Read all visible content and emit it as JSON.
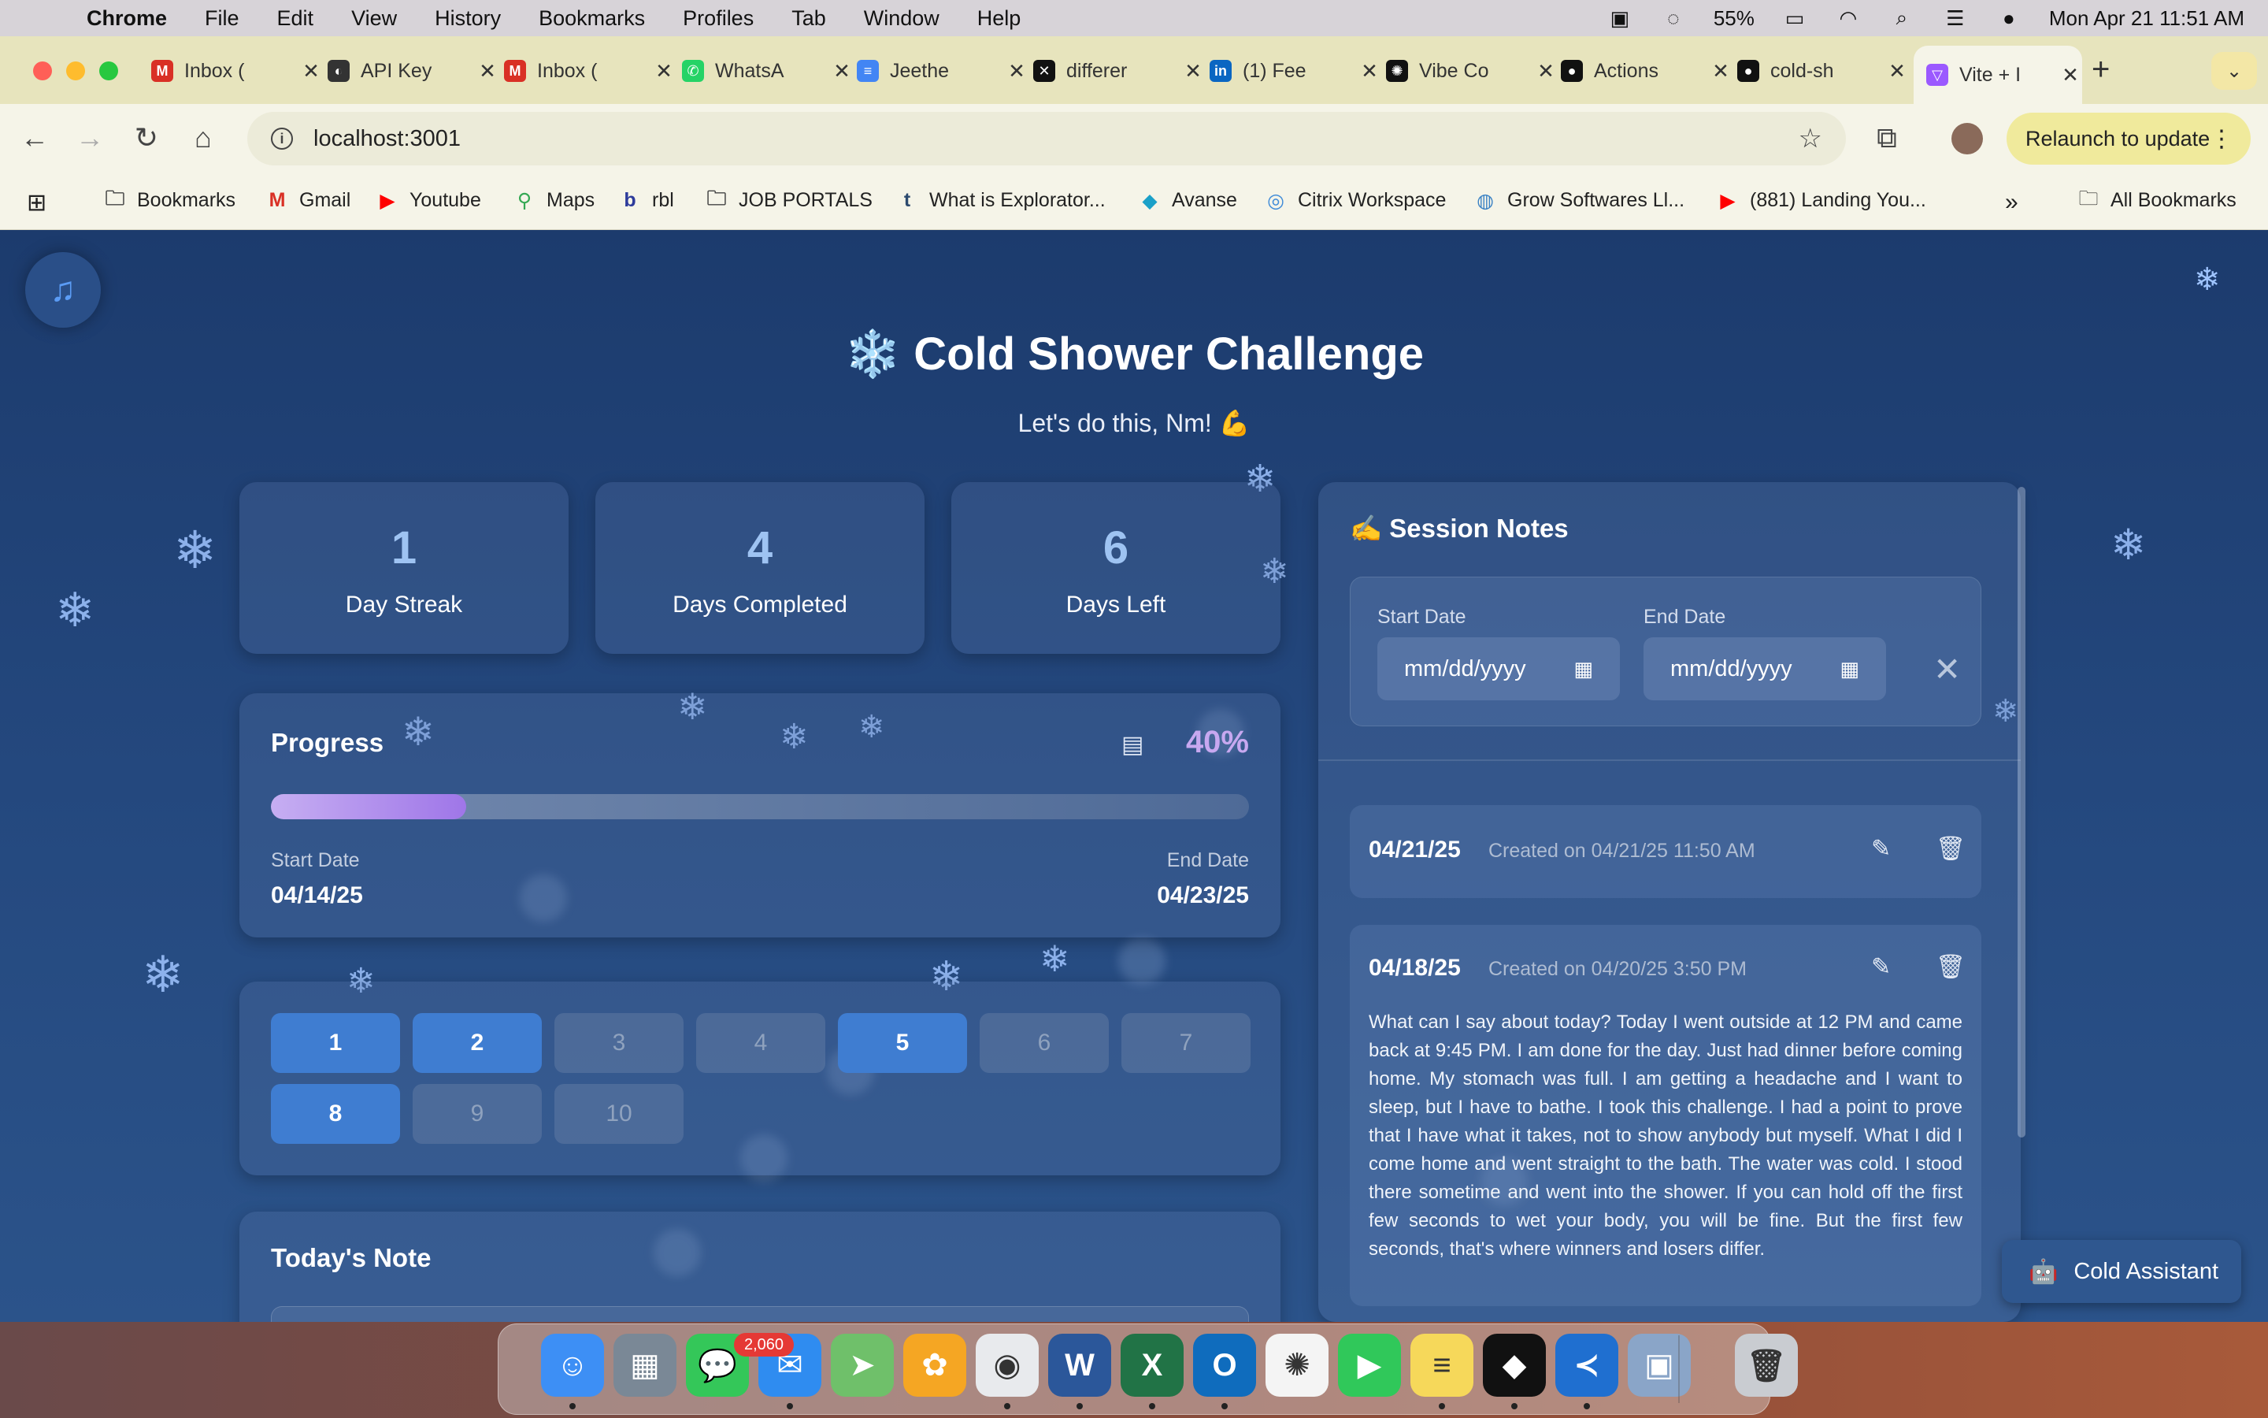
{
  "menubar": {
    "app": "Chrome",
    "items": [
      "File",
      "Edit",
      "View",
      "History",
      "Bookmarks",
      "Profiles",
      "Tab",
      "Window",
      "Help"
    ],
    "battery": "55%",
    "clock": "Mon Apr 21  11:51 AM"
  },
  "tabs": [
    {
      "title": "Inbox (",
      "icon": "gmail-icon",
      "color": "#d93025",
      "glyph": "M"
    },
    {
      "title": "API Key",
      "icon": "figma-icon",
      "color": "#333",
      "glyph": "◐"
    },
    {
      "title": "Inbox (",
      "icon": "gmail-icon",
      "color": "#d93025",
      "glyph": "M"
    },
    {
      "title": "WhatsA",
      "icon": "whatsapp-icon",
      "color": "#25d366",
      "glyph": "✆"
    },
    {
      "title": "Jeethe",
      "icon": "docs-icon",
      "color": "#4285f4",
      "glyph": "≡"
    },
    {
      "title": "differer",
      "icon": "site-icon",
      "color": "#111",
      "glyph": "✕"
    },
    {
      "title": "(1) Fee",
      "icon": "linkedin-icon",
      "color": "#0a66c2",
      "glyph": "in"
    },
    {
      "title": "Vibe Co",
      "icon": "openai-icon",
      "color": "#111",
      "glyph": "✺"
    },
    {
      "title": "Actions",
      "icon": "github-icon",
      "color": "#111",
      "glyph": "●"
    },
    {
      "title": "cold-sh",
      "icon": "github-icon",
      "color": "#111",
      "glyph": "●"
    },
    {
      "title": "Vite + I",
      "icon": "vite-icon",
      "color": "#9b59ff",
      "glyph": "▽",
      "active": true
    }
  ],
  "toolbar": {
    "url": "localhost:3001",
    "relaunch": "Relaunch to update"
  },
  "bookmarks": [
    {
      "label": "Bookmarks",
      "icon": "folder-icon"
    },
    {
      "label": "Gmail",
      "icon": "gmail-icon"
    },
    {
      "label": "Youtube",
      "icon": "youtube-icon"
    },
    {
      "label": "Maps",
      "icon": "maps-icon"
    },
    {
      "label": "rbl",
      "icon": "rbl-icon"
    },
    {
      "label": "JOB PORTALS",
      "icon": "folder-icon"
    },
    {
      "label": "What is Explorator...",
      "icon": "tds-icon"
    },
    {
      "label": "Avanse",
      "icon": "avanse-icon"
    },
    {
      "label": "Citrix Workspace",
      "icon": "citrix-icon"
    },
    {
      "label": "Grow Softwares Ll...",
      "icon": "globe-icon"
    },
    {
      "label": "(881) Landing You...",
      "icon": "youtube-icon"
    }
  ],
  "all_bookmarks": "All Bookmarks",
  "app": {
    "title": "❄️ Cold Shower Challenge",
    "subtitle": "Let's do this, Nm! 💪",
    "stats": [
      {
        "value": "1",
        "label": "Day Streak"
      },
      {
        "value": "4",
        "label": "Days Completed"
      },
      {
        "value": "6",
        "label": "Days Left"
      }
    ],
    "progress": {
      "title": "Progress",
      "percent_label": "40%",
      "fraction": 0.4,
      "start_label": "Start Date",
      "start_value": "04/14/25",
      "end_label": "End Date",
      "end_value": "04/23/25"
    },
    "days": [
      {
        "n": "1",
        "done": true
      },
      {
        "n": "2",
        "done": true
      },
      {
        "n": "3",
        "done": false
      },
      {
        "n": "4",
        "done": false
      },
      {
        "n": "5",
        "done": true
      },
      {
        "n": "6",
        "done": false
      },
      {
        "n": "7",
        "done": false
      },
      {
        "n": "8",
        "done": true
      },
      {
        "n": "9",
        "done": false
      },
      {
        "n": "10",
        "done": false
      }
    ],
    "todays_note_title": "Today's Note",
    "notes_panel": {
      "title": "✍️ Session Notes",
      "start_label": "Start Date",
      "end_label": "End Date",
      "start_placeholder": "mm/dd/yyyy",
      "end_placeholder": "mm/dd/yyyy",
      "notes": [
        {
          "date": "04/21/25",
          "created": "Created on 04/21/25 11:50 AM",
          "body": ""
        },
        {
          "date": "04/18/25",
          "created": "Created on 04/20/25 3:50 PM",
          "body": "What can I say about today? Today I went outside at 12 PM and came back at 9:45 PM. I am done for the day. Just had dinner before coming home. My stomach was full. I am getting a headache and I want to sleep, but I have to bathe. I took this challenge. I had a point to prove that I have what it takes, not to show anybody but myself. What I did I come home and went straight to the bath. The water was cold. I stood there sometime and went into the shower. If you can hold off the first few seconds to wet your body, you will be fine. But the first few seconds, that's where winners and losers differ."
        }
      ]
    },
    "assistant_label": "Cold Assistant"
  },
  "dock": {
    "mail_badge": "2,060",
    "apps": [
      {
        "name": "finder-icon",
        "color": "#3d8ff5",
        "glyph": "☺"
      },
      {
        "name": "launchpad-icon",
        "color": "#7a8896",
        "glyph": "▦"
      },
      {
        "name": "messages-icon",
        "color": "#34c759",
        "glyph": "💬"
      },
      {
        "name": "mail-icon",
        "color": "#2f8cf0",
        "glyph": "✉"
      },
      {
        "name": "maps-icon",
        "color": "#6fc06a",
        "glyph": "➤"
      },
      {
        "name": "photos-icon",
        "color": "#f5a623",
        "glyph": "✿"
      },
      {
        "name": "chrome-icon",
        "color": "#e8eaed",
        "glyph": "◉"
      },
      {
        "name": "word-icon",
        "color": "#2b579a",
        "glyph": "W"
      },
      {
        "name": "excel-icon",
        "color": "#217346",
        "glyph": "X"
      },
      {
        "name": "outlook-icon",
        "color": "#0f6cbd",
        "glyph": "O"
      },
      {
        "name": "chatgpt-icon",
        "color": "#f4f4f4",
        "glyph": "✺"
      },
      {
        "name": "facetime-icon",
        "color": "#30c85a",
        "glyph": "▶"
      },
      {
        "name": "notes-icon",
        "color": "#f6d85a",
        "glyph": "≡"
      },
      {
        "name": "cursor-icon",
        "color": "#111",
        "glyph": "◆"
      },
      {
        "name": "vscode-icon",
        "color": "#1f6fd0",
        "glyph": "≺"
      },
      {
        "name": "preview-icon",
        "color": "#8aa5c8",
        "glyph": "▣"
      },
      {
        "name": "trash-icon",
        "color": "#c9ccd1",
        "glyph": "🗑"
      }
    ]
  }
}
